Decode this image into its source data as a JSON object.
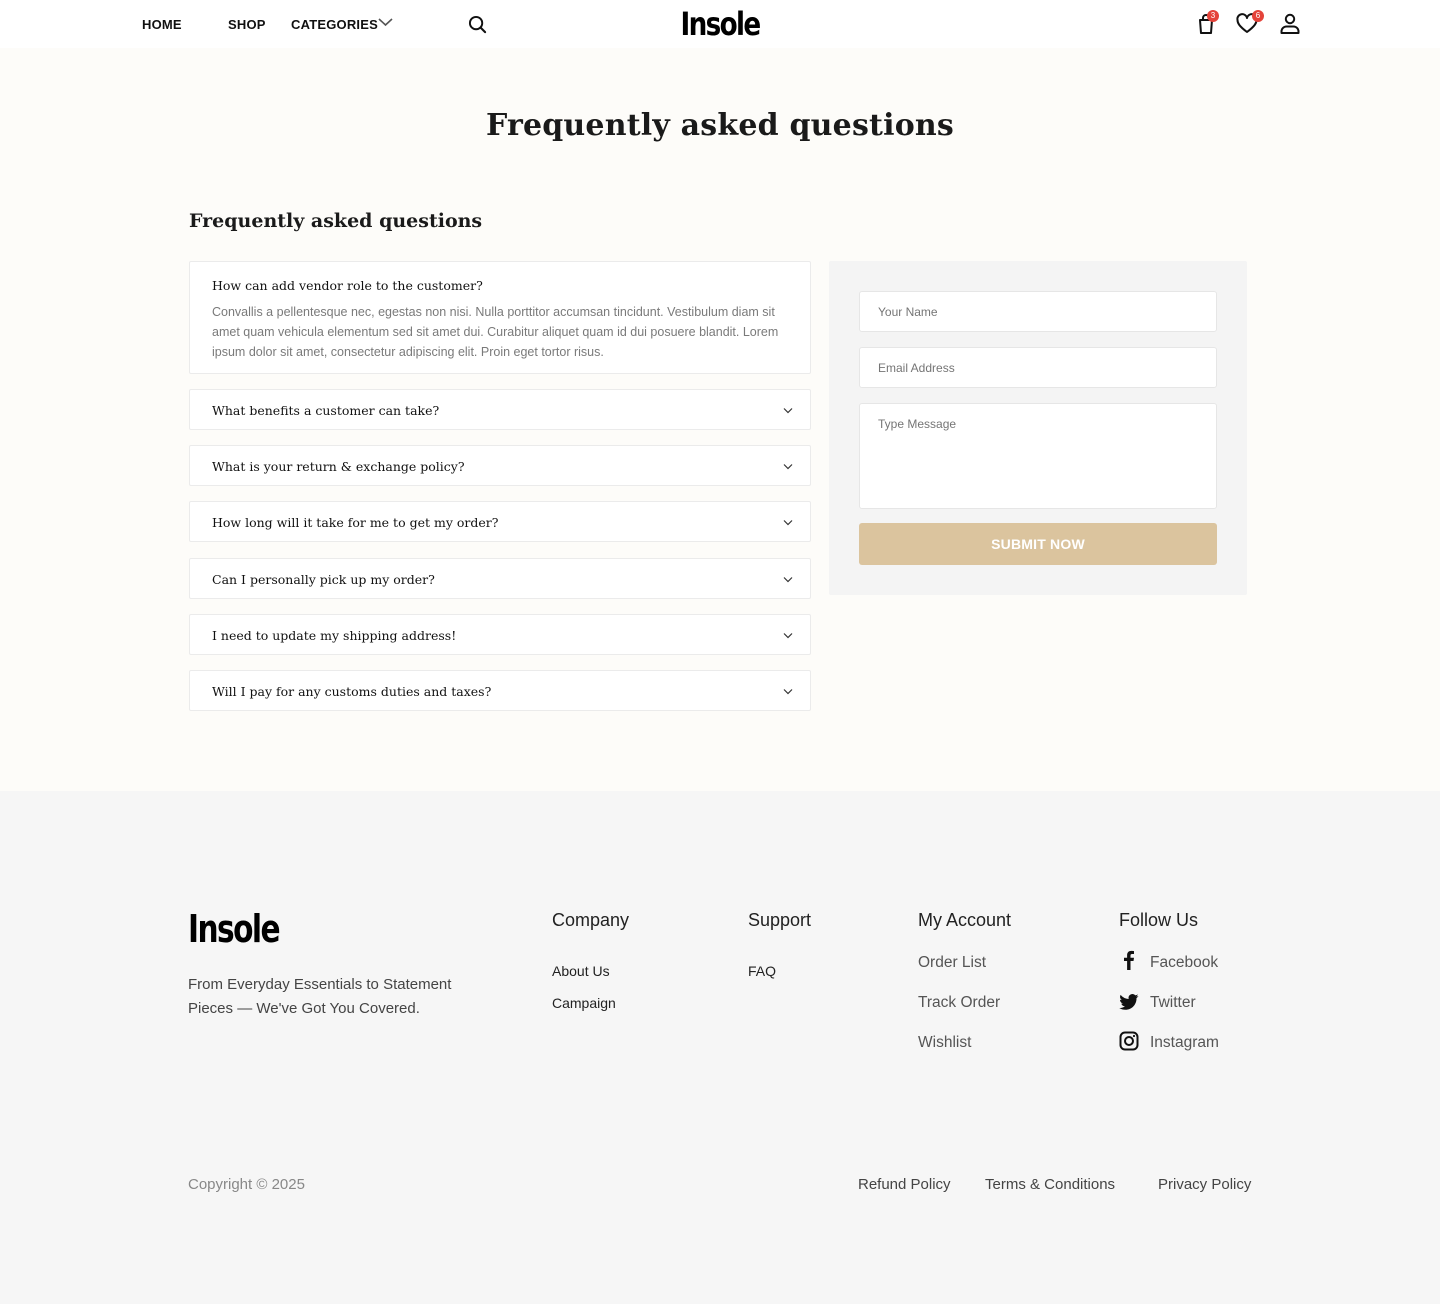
{
  "header": {
    "nav": {
      "home": "HOME",
      "shop": "SHOP",
      "categories": "CATEGORIES"
    },
    "logo": "Insole",
    "cart_count": "3",
    "wishlist_count": "6",
    "icons": [
      "chevron-down-icon",
      "search-icon",
      "cart-icon",
      "heart-icon",
      "user-icon"
    ]
  },
  "main": {
    "page_title": "Frequently asked questions",
    "section_title": "Frequently asked questions",
    "faqs": [
      {
        "question": "How can add vendor role to the customer?",
        "answer": "Convallis a pellentesque nec, egestas non nisi. Nulla porttitor accumsan tincidunt. Vestibulum diam sit amet quam vehicula elementum sed sit amet dui. Curabitur aliquet quam id dui posuere blandit. Lorem ipsum dolor sit amet, consectetur adipiscing elit. Proin eget tortor risus.",
        "expanded": true
      },
      {
        "question": "What benefits a customer can take?",
        "expanded": false
      },
      {
        "question": "What is your return & exchange policy?",
        "expanded": false
      },
      {
        "question": "How long will it take for me to get my order?",
        "expanded": false
      },
      {
        "question": "Can I personally pick up my order?",
        "expanded": false
      },
      {
        "question": "I need to update my shipping address!",
        "expanded": false
      },
      {
        "question": "Will I pay for any customs duties and taxes?",
        "expanded": false
      }
    ],
    "form": {
      "name_placeholder": "Your Name",
      "email_placeholder": "Email Address",
      "message_placeholder": "Type Message",
      "submit_label": "SUBMIT NOW"
    }
  },
  "footer": {
    "logo": "Insole",
    "tagline": "From Everyday Essentials to Statement Pieces — We've Got You Covered.",
    "company": {
      "heading": "Company",
      "links": [
        "About Us",
        "Campaign"
      ]
    },
    "support": {
      "heading": "Support",
      "links": [
        "FAQ"
      ]
    },
    "account": {
      "heading": "My Account",
      "links": [
        "Order List",
        "Track Order",
        "Wishlist"
      ]
    },
    "follow": {
      "heading": "Follow Us",
      "links": [
        "Facebook",
        "Twitter",
        "Instagram"
      ]
    },
    "copyright": "Copyright © 2025",
    "policies": [
      "Refund Policy",
      "Terms & Conditions",
      "Privacy Policy"
    ]
  },
  "colors": {
    "page_bg": "#fdfcf9",
    "footer_bg": "#f6f6f6",
    "accent_button": "#dbc49e",
    "badge": "#e4433a"
  }
}
